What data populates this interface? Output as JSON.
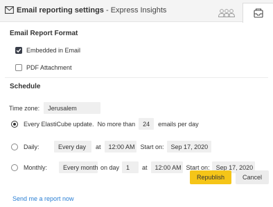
{
  "header": {
    "title": "Email reporting settings",
    "subtitle": "- Express Insights",
    "icon": "envelope-icon",
    "tabs": [
      {
        "icon": "people-icon",
        "active": false
      },
      {
        "icon": "inbox-icon",
        "active": true
      }
    ]
  },
  "format": {
    "title": "Email Report Format",
    "embedded_label": "Embedded in Email",
    "embedded_checked": true,
    "pdf_label": "PDF Attachment",
    "pdf_checked": false
  },
  "schedule": {
    "title": "Schedule",
    "timezone_label": "Time zone:",
    "timezone_value": "Jerusalem",
    "options": {
      "elasticube": {
        "selected": true,
        "label": "Every ElastiCube update.",
        "limit_prefix": "No more than",
        "limit_value": "24",
        "limit_suffix": "emails per day"
      },
      "daily": {
        "selected": false,
        "label": "Daily:",
        "frequency": "Every day",
        "at_label": "at",
        "time": "12:00 AM",
        "start_label": "Start on:",
        "start_date": "Sep 17, 2020"
      },
      "monthly": {
        "selected": false,
        "label": "Monthly:",
        "frequency": "Every month",
        "on_day_label": "on day",
        "day": "1",
        "at_label": "at",
        "time": "12:00 AM",
        "start_label": "Start on:",
        "start_date": "Sep 17, 2020"
      }
    }
  },
  "footer": {
    "send_link": "Send me a report now",
    "republish_label": "Republish",
    "cancel_label": "Cancel",
    "accent_color": "#f5c518",
    "link_color": "#2a7fd4"
  }
}
